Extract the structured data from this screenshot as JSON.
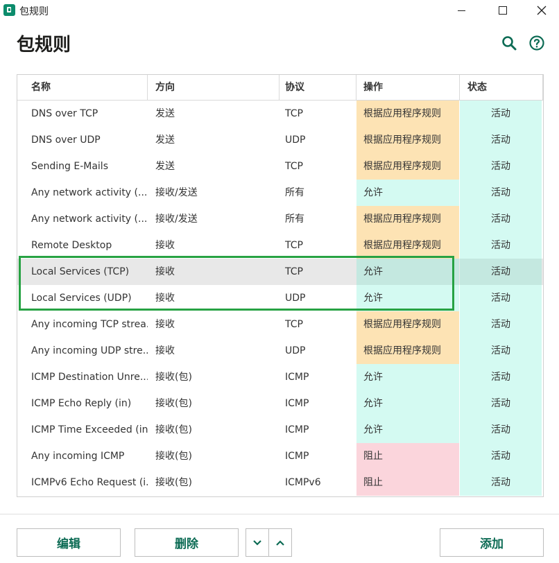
{
  "window": {
    "title": "包规则"
  },
  "header": {
    "title": "包规则",
    "search_icon": "search-icon",
    "help_icon": "help-icon"
  },
  "columns": [
    "名称",
    "方向",
    "协议",
    "操作",
    "状态"
  ],
  "colors": {
    "action_app_rules": "#fde3b4",
    "action_allow": "#d4faf2",
    "action_block": "#fbd5dc",
    "state_active": "#d4faf2",
    "highlight_border": "#27a243",
    "accent": "#0c6b54"
  },
  "rows": [
    {
      "name": "DNS over TCP",
      "direction": "发送",
      "protocol": "TCP",
      "action": "根据应用程序规则",
      "action_type": "app",
      "state": "活动"
    },
    {
      "name": "DNS over UDP",
      "direction": "发送",
      "protocol": "UDP",
      "action": "根据应用程序规则",
      "action_type": "app",
      "state": "活动"
    },
    {
      "name": "Sending E-Mails",
      "direction": "发送",
      "protocol": "TCP",
      "action": "根据应用程序规则",
      "action_type": "app",
      "state": "活动"
    },
    {
      "name": "Any network activity (...",
      "direction": "接收/发送",
      "protocol": "所有",
      "action": "允许",
      "action_type": "allow",
      "state": "活动"
    },
    {
      "name": "Any network activity (...",
      "direction": "接收/发送",
      "protocol": "所有",
      "action": "根据应用程序规则",
      "action_type": "app",
      "state": "活动"
    },
    {
      "name": "Remote Desktop",
      "direction": "接收",
      "protocol": "TCP",
      "action": "根据应用程序规则",
      "action_type": "app",
      "state": "活动"
    },
    {
      "name": "Local Services (TCP)",
      "direction": "接收",
      "protocol": "TCP",
      "action": "允许",
      "action_type": "allow",
      "state": "活动",
      "selected": true
    },
    {
      "name": "Local Services (UDP)",
      "direction": "接收",
      "protocol": "UDP",
      "action": "允许",
      "action_type": "allow",
      "state": "活动"
    },
    {
      "name": "Any incoming TCP strea...",
      "direction": "接收",
      "protocol": "TCP",
      "action": "根据应用程序规则",
      "action_type": "app",
      "state": "活动"
    },
    {
      "name": "Any incoming UDP stre...",
      "direction": "接收",
      "protocol": "UDP",
      "action": "根据应用程序规则",
      "action_type": "app",
      "state": "活动"
    },
    {
      "name": "ICMP Destination Unre...",
      "direction": "接收(包)",
      "protocol": "ICMP",
      "action": "允许",
      "action_type": "allow",
      "state": "活动"
    },
    {
      "name": "ICMP Echo Reply (in)",
      "direction": "接收(包)",
      "protocol": "ICMP",
      "action": "允许",
      "action_type": "allow",
      "state": "活动"
    },
    {
      "name": "ICMP Time Exceeded (in)",
      "direction": "接收(包)",
      "protocol": "ICMP",
      "action": "允许",
      "action_type": "allow",
      "state": "活动"
    },
    {
      "name": "Any incoming ICMP",
      "direction": "接收(包)",
      "protocol": "ICMP",
      "action": "阻止",
      "action_type": "block",
      "state": "活动"
    },
    {
      "name": "ICMPv6 Echo Request (i...",
      "direction": "接收(包)",
      "protocol": "ICMPv6",
      "action": "阻止",
      "action_type": "block",
      "state": "活动"
    }
  ],
  "footer": {
    "edit_label": "编辑",
    "delete_label": "删除",
    "move_down_icon": "chevron-down-icon",
    "move_up_icon": "chevron-up-icon",
    "add_label": "添加"
  }
}
